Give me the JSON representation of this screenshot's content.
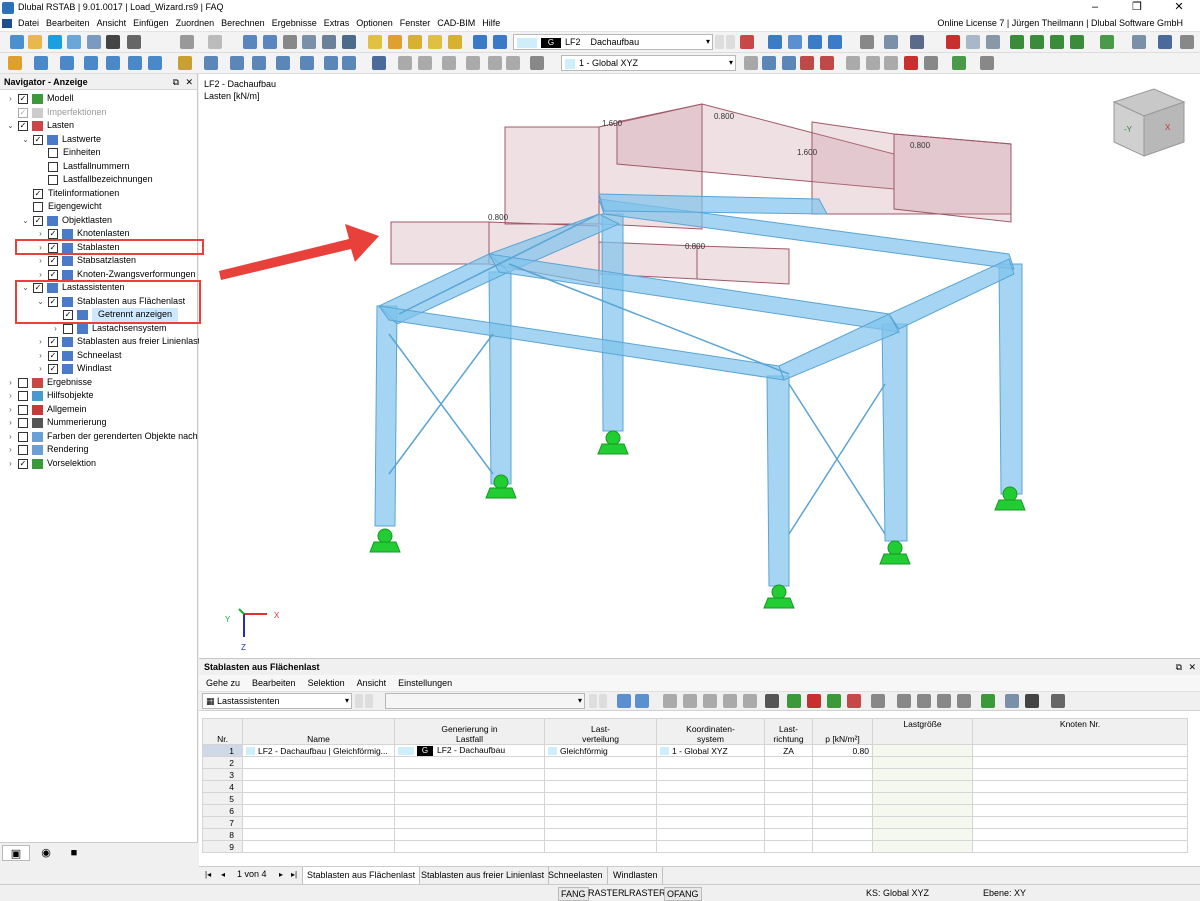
{
  "window": {
    "title": "Dlubal RSTAB | 9.01.0017 | Load_Wizard.rs9 | FAQ",
    "buttons": [
      "–",
      "❐",
      "✕"
    ]
  },
  "menubar": {
    "items": [
      "Datei",
      "Bearbeiten",
      "Ansicht",
      "Einfügen",
      "Zuordnen",
      "Berechnen",
      "Ergebnisse",
      "Extras",
      "Optionen",
      "Fenster",
      "CAD-BIM",
      "Hilfe"
    ],
    "license": "Online License 7 | Jürgen Theilmann | Dlubal Software GmbH"
  },
  "toolbar": {
    "loadcase_id": "LF2",
    "loadcase_tag": "G",
    "loadcase_name": "Dachaufbau",
    "coord_system": "1 - Global XYZ"
  },
  "navigator": {
    "title": "Navigator - Anzeige",
    "items": [
      {
        "label": "Modell"
      },
      {
        "label": "Imperfektionen"
      },
      {
        "label": "Lasten"
      },
      {
        "label": "Lastwerte"
      },
      {
        "label": "Einheiten"
      },
      {
        "label": "Lastfallnummern"
      },
      {
        "label": "Lastfallbezeichnungen"
      },
      {
        "label": "Titelinformationen"
      },
      {
        "label": "Eigengewicht"
      },
      {
        "label": "Objektlasten"
      },
      {
        "label": "Knotenlasten"
      },
      {
        "label": "Stablasten"
      },
      {
        "label": "Stabsatzlasten"
      },
      {
        "label": "Knoten-Zwangsverformungen"
      },
      {
        "label": "Lastassistenten"
      },
      {
        "label": "Stablasten aus Flächenlast"
      },
      {
        "label": "Getrennt anzeigen"
      },
      {
        "label": "Lastachsensystem"
      },
      {
        "label": "Stablasten aus freier Linienlast"
      },
      {
        "label": "Schneelast"
      },
      {
        "label": "Windlast"
      },
      {
        "label": "Ergebnisse"
      },
      {
        "label": "Hilfsobjekte"
      },
      {
        "label": "Allgemein"
      },
      {
        "label": "Nummerierung"
      },
      {
        "label": "Farben der gerenderten Objekte nach"
      },
      {
        "label": "Rendering"
      },
      {
        "label": "Vorselektion"
      }
    ]
  },
  "viewport": {
    "title_line1": "LF2 - Dachaufbau",
    "title_line2": "Lasten [kN/m]",
    "load_labels": [
      "1.600",
      "0.800",
      "1.600",
      "0.800",
      "0.800",
      "0.800"
    ],
    "axes": {
      "x": "X",
      "y": "Y",
      "z": "Z"
    },
    "cube_labels": {
      "front": "-Y",
      "right": "X"
    },
    "colors": {
      "member": "#7fc3ec",
      "load": "#c7909c",
      "support": "#22cc33",
      "arrow": "#e8403a"
    }
  },
  "table": {
    "title": "Stablasten aus Flächenlast",
    "menu": [
      "Gehe zu",
      "Bearbeiten",
      "Selektion",
      "Ansicht",
      "Einstellungen"
    ],
    "filter": "Lastassistenten",
    "columns": {
      "nr": "Nr.",
      "name": "Name",
      "gen_1": "Generierung in",
      "gen_2": "Lastfall",
      "dist_1": "Last-",
      "dist_2": "verteilung",
      "cs_1": "Koordinaten-",
      "cs_2": "system",
      "dir_1": "Last-",
      "dir_2": "richtung",
      "p": "p [kN/m²]",
      "size": "Lastgröße",
      "nodes": "Knoten Nr."
    },
    "row1": {
      "nr": "1",
      "name": "LF2 - Dachaufbau | Gleichförmig...",
      "lc_tag": "G",
      "lc": "LF2 - Dachaufbau",
      "dist": "Gleichförmig",
      "cs": "1 - Global XYZ",
      "dir": "ZA",
      "p": "0.80"
    },
    "empty_rows": [
      "2",
      "3",
      "4",
      "5",
      "6",
      "7",
      "8",
      "9"
    ],
    "pager": "1 von 4",
    "tabs": [
      "Stablasten aus Flächenlast",
      "Stablasten aus freier Linienlast",
      "Schneelasten",
      "Windlasten"
    ]
  },
  "statusbar": {
    "buttons": [
      "FANG",
      "RASTER",
      "LRASTER",
      "OFANG"
    ],
    "ks": "KS: Global XYZ",
    "plane": "Ebene: XY"
  }
}
